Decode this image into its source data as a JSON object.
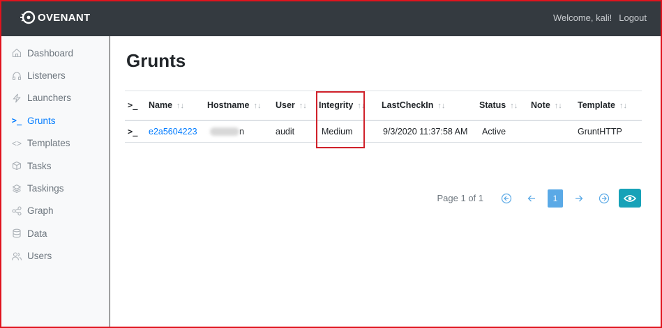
{
  "app": {
    "brand": "OVENANT",
    "brand_mark": "C"
  },
  "navbar": {
    "welcome": "Welcome, kali!",
    "logout": "Logout"
  },
  "sidebar": {
    "items": [
      {
        "label": "Dashboard",
        "icon": "home-icon",
        "active": false
      },
      {
        "label": "Listeners",
        "icon": "headphones-icon",
        "active": false
      },
      {
        "label": "Launchers",
        "icon": "lightning-icon",
        "active": false
      },
      {
        "label": "Grunts",
        "icon": "terminal-icon",
        "active": true
      },
      {
        "label": "Templates",
        "icon": "code-icon",
        "active": false
      },
      {
        "label": "Tasks",
        "icon": "box-icon",
        "active": false
      },
      {
        "label": "Taskings",
        "icon": "layers-icon",
        "active": false
      },
      {
        "label": "Graph",
        "icon": "share-icon",
        "active": false
      },
      {
        "label": "Data",
        "icon": "database-icon",
        "active": false
      },
      {
        "label": "Users",
        "icon": "users-icon",
        "active": false
      }
    ]
  },
  "main": {
    "title": "Grunts",
    "table": {
      "prompt_symbol": ">_",
      "sort_symbol": "↑↓",
      "columns": [
        "Name",
        "Hostname",
        "User",
        "Integrity",
        "LastCheckIn",
        "Status",
        "Note",
        "Template"
      ],
      "rows": [
        {
          "prompt": ">_",
          "name": "e2a5604223",
          "hostname": "n",
          "user": "audit",
          "integrity": "Medium",
          "last_checkin": "9/3/2020 11:37:58 AM",
          "status": "Active",
          "note": "",
          "template": "GruntHTTP"
        }
      ]
    },
    "pagination": {
      "text": "Page 1 of 1",
      "current_page": "1"
    }
  },
  "colors": {
    "navbar": "#343a40",
    "accent": "#007bff",
    "info": "#17a2b8",
    "highlight": "#d0212a"
  }
}
